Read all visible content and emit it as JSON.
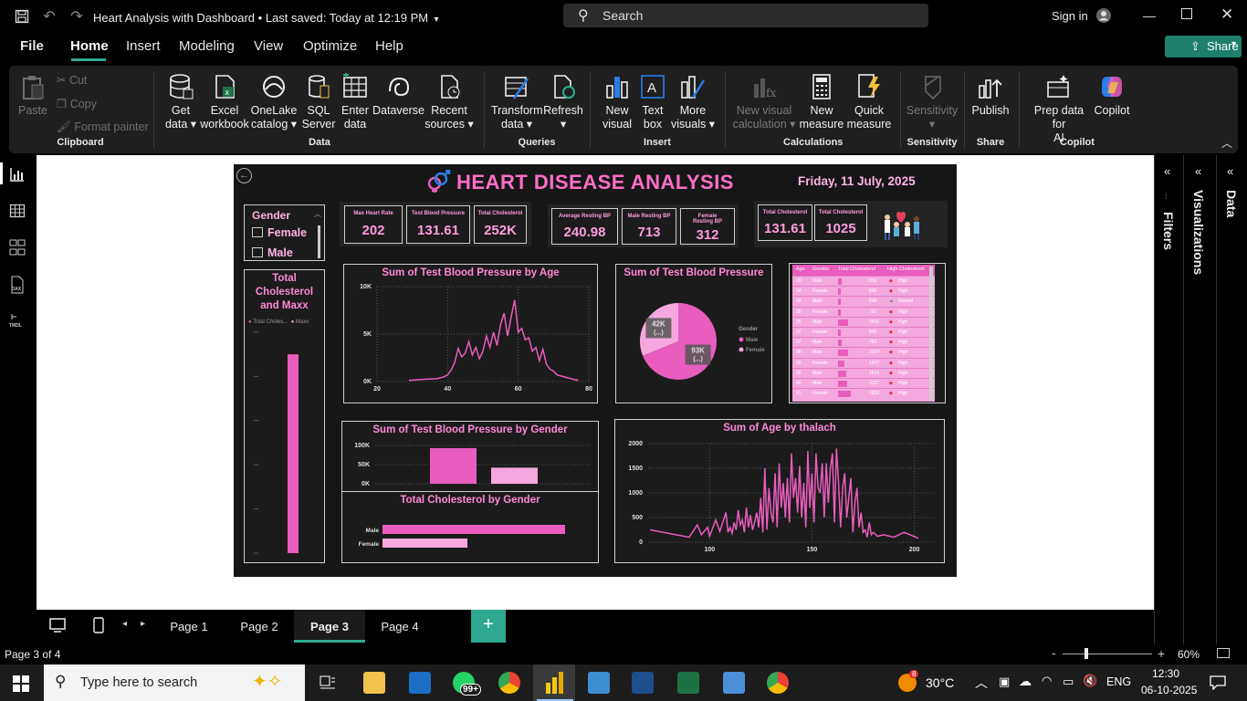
{
  "window": {
    "title": "Heart Analysis with Dashboard",
    "saved": "Last saved: Today at 12:19 PM",
    "search_label": "Search",
    "signin": "Sign in"
  },
  "menu": {
    "tabs": [
      "File",
      "Home",
      "Insert",
      "Modeling",
      "View",
      "Optimize",
      "Help"
    ],
    "share": "Share"
  },
  "ribbon": {
    "clipboard": {
      "paste": "Paste",
      "cut": "Cut",
      "copy": "Copy",
      "format_painter": "Format painter",
      "group": "Clipboard"
    },
    "data": {
      "get_data": [
        "Get",
        "data"
      ],
      "excel": [
        "Excel",
        "workbook"
      ],
      "onelake": [
        "OneLake",
        "catalog"
      ],
      "sql": [
        "SQL",
        "Server"
      ],
      "enter": [
        "Enter",
        "data"
      ],
      "dataverse": "Dataverse",
      "recent": [
        "Recent",
        "sources"
      ],
      "group": "Data"
    },
    "queries": {
      "transform": [
        "Transform",
        "data"
      ],
      "refresh": "Refresh",
      "group": "Queries"
    },
    "insert": {
      "new_visual": [
        "New",
        "visual"
      ],
      "text_box": [
        "Text",
        "box"
      ],
      "more_visuals": [
        "More",
        "visuals"
      ],
      "group": "Insert"
    },
    "calculations": {
      "new_visual_calc": [
        "New visual",
        "calculation"
      ],
      "new_measure": [
        "New",
        "measure"
      ],
      "quick_measure": [
        "Quick",
        "measure"
      ],
      "group": "Calculations"
    },
    "sensitivity": {
      "label": "Sensitivity",
      "group": "Sensitivity"
    },
    "share": {
      "publish": "Publish",
      "group": "Share"
    },
    "copilot": {
      "prep": [
        "Prep data for",
        "AI"
      ],
      "copilot": "Copilot",
      "group": "Copilot"
    }
  },
  "panes": {
    "filters": "Filters",
    "visualizations": "Visualizations",
    "data": "Data"
  },
  "report": {
    "title": "HEART DISEASE ANALYSIS",
    "date": "Friday, 11 July, 2025",
    "slicer": {
      "title": "Gender",
      "items": [
        "Female",
        "Male"
      ]
    },
    "kpis": [
      {
        "label": "Max Heart Rate",
        "value": "202"
      },
      {
        "label": "Test Blood Pressure",
        "value": "131.61"
      },
      {
        "label": "Total Cholesterol",
        "value": "252K"
      },
      {
        "label": "Average Resting BP",
        "value": "240.98"
      },
      {
        "label": "Male Resting BP",
        "value": "713"
      },
      {
        "label": "Female Resting BP",
        "value": "312"
      },
      {
        "label": "Total Cholesterol",
        "value": "131.61"
      },
      {
        "label": "Total Cholesterol",
        "value": "1025"
      }
    ],
    "left_visual": {
      "title": "Total Cholesterol and Maxx",
      "legend": [
        "Total Choles...",
        "Maxx"
      ]
    },
    "table": {
      "headers": [
        "Age",
        "Gender",
        "Total Cholesterol",
        "High Cholesterol"
      ],
      "rows": [
        [
          "29",
          "Male",
          "816",
          "High"
        ],
        [
          "34",
          "Female",
          "630",
          "High"
        ],
        [
          "34",
          "Male",
          "548",
          "Normal"
        ],
        [
          "35",
          "Female",
          "732",
          "High"
        ],
        [
          "35",
          "Male",
          "2406",
          "High"
        ],
        [
          "37",
          "Female",
          "645",
          "High"
        ],
        [
          "37",
          "Male",
          "750",
          "High"
        ],
        [
          "38",
          "Male",
          "2324",
          "High"
        ],
        [
          "39",
          "Female",
          "1477",
          "High"
        ],
        [
          "39",
          "Male",
          "1839",
          "High"
        ],
        [
          "40",
          "Male",
          "2157",
          "High"
        ],
        [
          "41",
          "Female",
          "2928",
          "High"
        ]
      ]
    }
  },
  "chart_data": [
    {
      "type": "line",
      "title": "Sum of Test Blood Pressure by Age",
      "x": [
        29,
        34,
        37,
        39,
        40,
        41,
        42,
        43,
        44,
        45,
        46,
        47,
        48,
        49,
        50,
        51,
        52,
        53,
        54,
        55,
        56,
        57,
        58,
        59,
        60,
        61,
        62,
        63,
        64,
        65,
        66,
        67,
        68,
        69,
        70,
        71,
        74,
        76,
        77
      ],
      "y": [
        120,
        250,
        300,
        500,
        700,
        1200,
        2000,
        3500,
        2600,
        3000,
        4200,
        2800,
        3600,
        2400,
        3200,
        4800,
        3600,
        5200,
        3800,
        6000,
        7200,
        4800,
        6800,
        8600,
        5200,
        5600,
        4400,
        4600,
        3200,
        3600,
        2200,
        3400,
        1800,
        1300,
        1100,
        700,
        400,
        200,
        130
      ],
      "xlim": [
        20,
        80
      ],
      "ylim": [
        0,
        10000
      ],
      "yticks": [
        "0K",
        "5K",
        "10K"
      ],
      "xticks": [
        "20",
        "40",
        "60",
        "80"
      ]
    },
    {
      "type": "pie",
      "title": "Sum of Test Blood Pressure",
      "legend_title": "Gender",
      "series": [
        {
          "name": "Male",
          "value": 93000,
          "label": "93K",
          "sublabel": "(...)",
          "color": "#e85dbd"
        },
        {
          "name": "Female",
          "value": 42000,
          "label": "42K",
          "sublabel": "(...)",
          "color": "#f4a8dd"
        }
      ]
    },
    {
      "type": "bar",
      "title": "Sum of Test Blood Pressure by Gender",
      "categories": [
        "Male",
        "Female"
      ],
      "values": [
        93000,
        42000
      ],
      "ylim": [
        0,
        100000
      ],
      "yticks": [
        "0K",
        "50K",
        "100K"
      ]
    },
    {
      "type": "bar",
      "orientation": "horizontal",
      "title": "Total Cholesterol by Gender",
      "categories": [
        "Male",
        "Female"
      ],
      "values": [
        172000,
        80000
      ]
    },
    {
      "type": "line",
      "title": "Sum of Age by thalach",
      "x": [
        71,
        90,
        94,
        96,
        99,
        100,
        103,
        105,
        108,
        109,
        110,
        111,
        112,
        113,
        114,
        115,
        116,
        117,
        118,
        119,
        120,
        121,
        122,
        123,
        124,
        125,
        126,
        127,
        128,
        129,
        130,
        131,
        132,
        133,
        134,
        135,
        136,
        137,
        138,
        139,
        140,
        141,
        142,
        143,
        144,
        145,
        146,
        147,
        148,
        149,
        150,
        151,
        152,
        153,
        154,
        155,
        156,
        157,
        158,
        159,
        160,
        161,
        162,
        163,
        164,
        165,
        166,
        167,
        168,
        169,
        170,
        171,
        172,
        173,
        174,
        175,
        176,
        177,
        178,
        179,
        180,
        182,
        185,
        190,
        195,
        202
      ],
      "y": [
        250,
        100,
        350,
        150,
        300,
        120,
        450,
        220,
        600,
        200,
        300,
        180,
        400,
        250,
        650,
        350,
        450,
        200,
        700,
        300,
        550,
        250,
        400,
        600,
        300,
        900,
        200,
        1500,
        250,
        1100,
        600,
        400,
        1400,
        300,
        1600,
        700,
        1200,
        500,
        1300,
        400,
        1800,
        900,
        1300,
        600,
        1550,
        500,
        1200,
        300,
        1850,
        700,
        1400,
        400,
        1800,
        1100,
        1000,
        1600,
        500,
        1600,
        800,
        1500,
        1800,
        400,
        1900,
        1200,
        300,
        1100,
        1400,
        500,
        900,
        1300,
        200,
        800,
        1100,
        300,
        600,
        200,
        250,
        100,
        400,
        150,
        200,
        120,
        150,
        100,
        200,
        80
      ],
      "xlim": [
        70,
        210
      ],
      "ylim": [
        0,
        2000
      ],
      "yticks": [
        "0",
        "500",
        "1000",
        "1500",
        "2000"
      ],
      "xticks": [
        "100",
        "150",
        "200"
      ]
    },
    {
      "type": "bar",
      "title": "Total Cholesterol and Maxx",
      "categories": [
        "Total Cholesterol"
      ],
      "values": [
        252000
      ],
      "ylim": [
        0,
        280000
      ]
    }
  ],
  "pages": [
    "Page 1",
    "Page 2",
    "Page 3",
    "Page 4"
  ],
  "status": {
    "page_of": "Page 3 of 4",
    "zoom": "60%"
  },
  "taskbar": {
    "search": "Type here to search",
    "whatsapp_badge": "99+",
    "weather_badge": "8",
    "temp": "30°C",
    "lang": "ENG",
    "time": "12:30",
    "date": "06-10-2025"
  },
  "colors": {
    "accent": "#2ea98f",
    "pink_primary": "#e85dbd",
    "pink_light": "#f4a8dd",
    "pink_text": "#ff6ec7"
  }
}
